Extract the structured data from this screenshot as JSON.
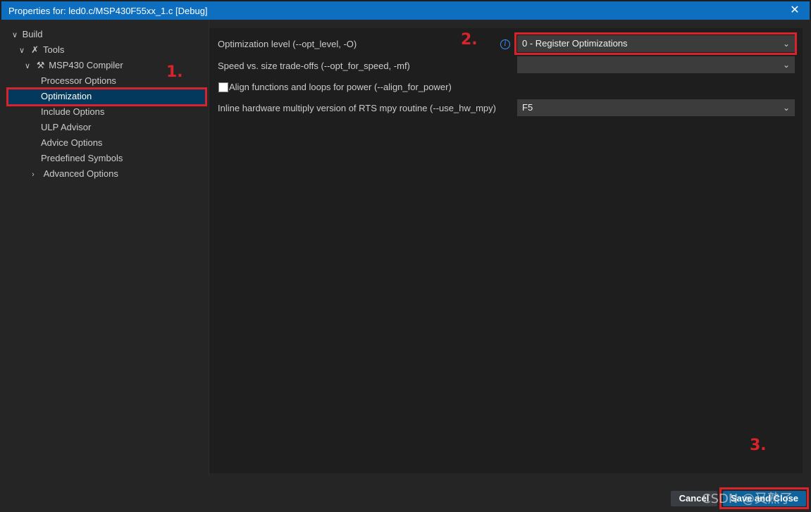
{
  "window": {
    "title": "Properties for: led0.c/MSP430F55xx_1.c [Debug]",
    "close_glyph": "✕"
  },
  "tree": {
    "build": "Build",
    "tools": "Tools",
    "compiler": "MSP430 Compiler",
    "items": [
      "Processor Options",
      "Optimization",
      "Include Options",
      "ULP Advisor",
      "Advice Options",
      "Predefined Symbols",
      "Advanced Options"
    ],
    "selected": "Optimization"
  },
  "settings": {
    "opt_level_label": "Optimization level (--opt_level, -O)",
    "opt_level_value": "0 - Register Optimizations",
    "speed_label": "Speed vs. size trade-offs (--opt_for_speed, -mf)",
    "speed_value": "",
    "align_label": "Align functions and loops for power (--align_for_power)",
    "align_checked": false,
    "hw_mpy_label": "Inline hardware multiply version of RTS mpy routine (--use_hw_mpy)",
    "hw_mpy_value": "F5"
  },
  "annotations": {
    "step1": "1.",
    "step2": "2.",
    "step3": "3."
  },
  "buttons": {
    "cancel": "Cancel",
    "save_close": "Save and Close"
  },
  "watermark": "CSDN @又熟了",
  "colors": {
    "accent": "#0e6fc1",
    "annotation_red": "#d8232a",
    "selection": "#04395e"
  }
}
